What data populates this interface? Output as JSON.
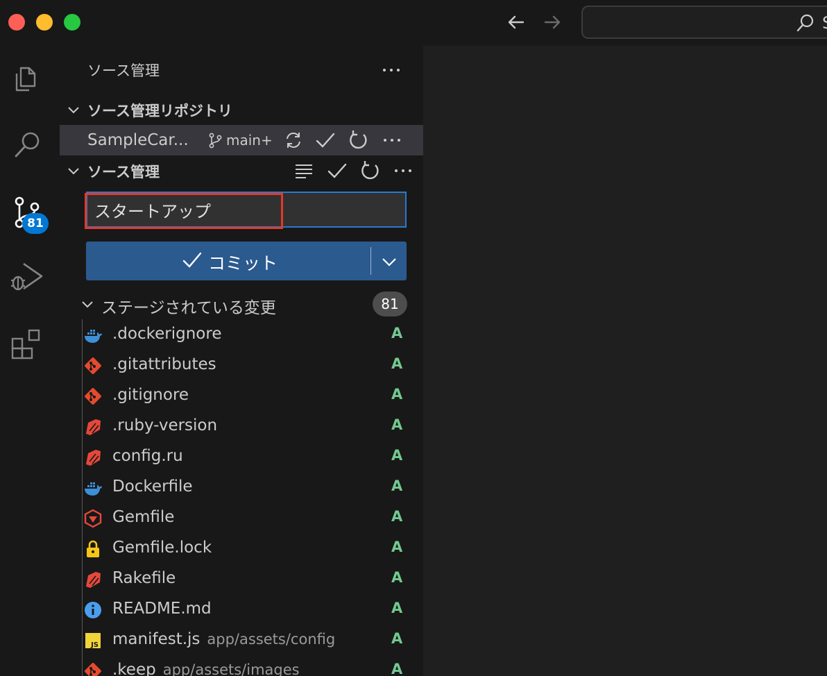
{
  "titlebar": {
    "command_center_text": "S"
  },
  "activity_bar": {
    "scm_badge": "81"
  },
  "sidebar": {
    "title": "ソース管理",
    "repositories_section": "ソース管理リポジトリ",
    "repo": {
      "name": "SampleCar...",
      "branch": "main+"
    },
    "changes_section": "ソース管理",
    "commit_message": "スタートアップ",
    "commit_button": "コミット",
    "staged": {
      "label": "ステージされている変更",
      "count": "81",
      "files": [
        {
          "name": ".dockerignore",
          "path": "",
          "status": "A",
          "icon": "docker-icon"
        },
        {
          "name": ".gitattributes",
          "path": "",
          "status": "A",
          "icon": "git-icon"
        },
        {
          "name": ".gitignore",
          "path": "",
          "status": "A",
          "icon": "git-icon"
        },
        {
          "name": ".ruby-version",
          "path": "",
          "status": "A",
          "icon": "ruby-icon"
        },
        {
          "name": "config.ru",
          "path": "",
          "status": "A",
          "icon": "ruby-icon"
        },
        {
          "name": "Dockerfile",
          "path": "",
          "status": "A",
          "icon": "docker-icon"
        },
        {
          "name": "Gemfile",
          "path": "",
          "status": "A",
          "icon": "gemfile-icon"
        },
        {
          "name": "Gemfile.lock",
          "path": "",
          "status": "A",
          "icon": "lock-icon"
        },
        {
          "name": "Rakefile",
          "path": "",
          "status": "A",
          "icon": "ruby-icon"
        },
        {
          "name": "README.md",
          "path": "",
          "status": "A",
          "icon": "info-icon"
        },
        {
          "name": "manifest.js",
          "path": "app/assets/config",
          "status": "A",
          "icon": "js-icon"
        },
        {
          "name": ".keep",
          "path": "app/assets/images",
          "status": "A",
          "icon": "git-icon"
        }
      ]
    }
  },
  "colors": {
    "accent": "#2b79d0",
    "commit_button": "#2b5a8f",
    "highlight": "#e53828",
    "status_added": "#73c991"
  }
}
